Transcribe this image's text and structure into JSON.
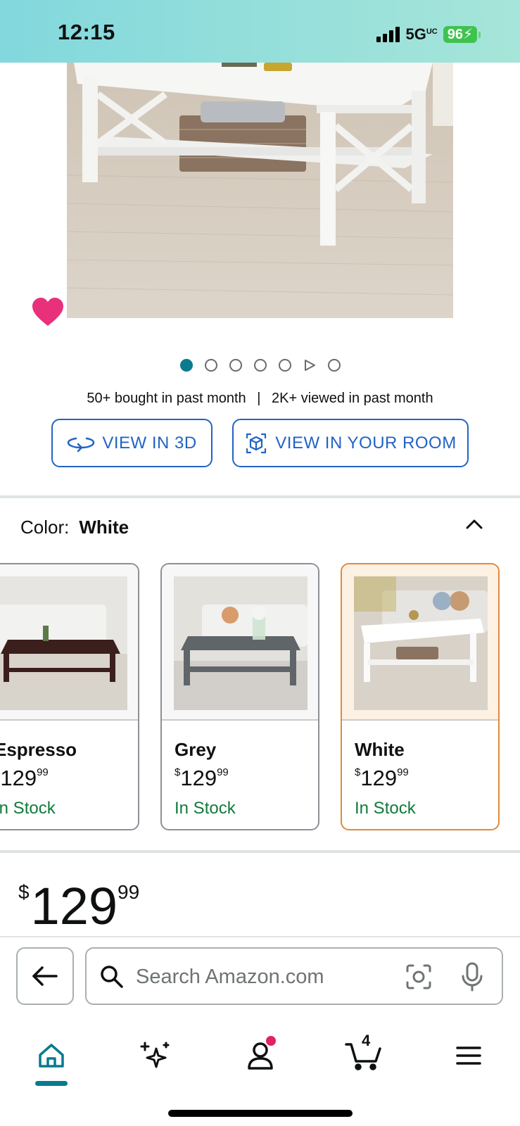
{
  "status_bar": {
    "time": "12:15",
    "network": "5G",
    "network_suffix": "UC",
    "battery": "96"
  },
  "product": {
    "carousel_total": 7,
    "carousel_active": 1,
    "stats_bought": "50+ bought in past month",
    "stats_separator": "|",
    "stats_viewed": "2K+ viewed in past month",
    "view_3d_label": "VIEW IN 3D",
    "view_room_label": "VIEW IN YOUR ROOM"
  },
  "color": {
    "label": "Color:",
    "value": "White",
    "options": [
      {
        "name": "Espresso",
        "currency": "$",
        "price_whole": "129",
        "price_fraction": "99",
        "stock": "In Stock"
      },
      {
        "name": "Grey",
        "currency": "$",
        "price_whole": "129",
        "price_fraction": "99",
        "stock": "In Stock"
      },
      {
        "name": "White",
        "currency": "$",
        "price_whole": "129",
        "price_fraction": "99",
        "stock": "In Stock"
      }
    ]
  },
  "price": {
    "currency": "$",
    "whole": "129",
    "fraction": "99"
  },
  "search": {
    "placeholder": "Search Amazon.com"
  },
  "tab_bar": {
    "cart_count": "4",
    "tabs": [
      "home-icon",
      "rufus-sparkle-icon",
      "account-icon",
      "cart-icon",
      "menu-icon"
    ]
  },
  "colors": {
    "accent_teal": "#0a7a8f",
    "link_blue": "#2164c4",
    "in_stock_green": "#127a3b",
    "selected_orange": "#e08a3c",
    "heart_pink": "#e0245e"
  }
}
